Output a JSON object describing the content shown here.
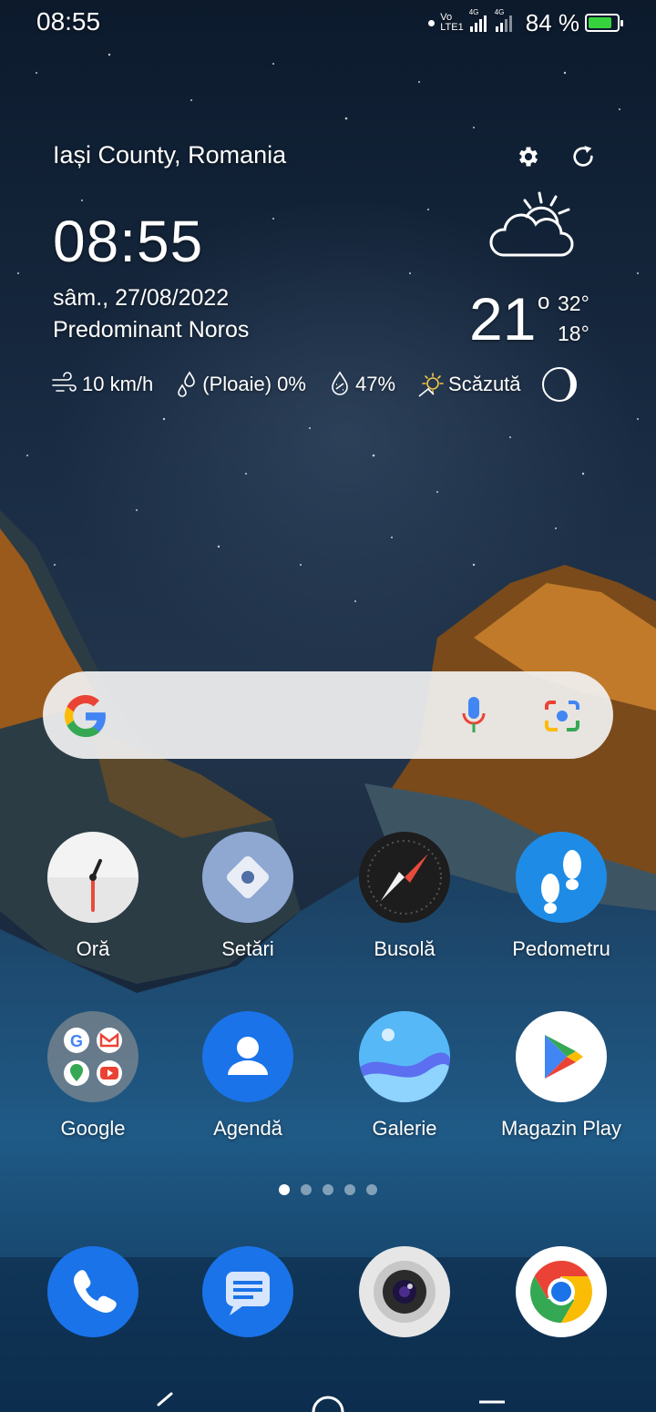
{
  "status_bar": {
    "time": "08:55",
    "volte_top": "Vo",
    "volte_bottom": "LTE1",
    "network_1": "4G",
    "network_2": "4G",
    "battery_percent": "84 %",
    "battery_level": 0.84,
    "battery_color": "#37d33e"
  },
  "weather": {
    "location": "Iași County, Romania",
    "time": "08:55",
    "date": "sâm., 27/08/2022",
    "condition": "Predominant Noros",
    "temperature": "21",
    "degree_symbol": "o",
    "high": "32°",
    "low": "18°",
    "wind": "10 km/h",
    "precipitation": "(Ploaie) 0%",
    "humidity": "47%",
    "uv": "Scăzută",
    "settings_icon": "gear-icon",
    "refresh_icon": "refresh-icon",
    "condition_icon": "partly-cloudy-icon",
    "moon_icon": "moon-phase-icon"
  },
  "search_bar": {
    "logo_icon": "google-g-icon",
    "mic_icon": "microphone-icon",
    "lens_icon": "lens-camera-icon"
  },
  "apps": [
    {
      "label": "Oră",
      "icon": "clock-icon"
    },
    {
      "label": "Setări",
      "icon": "settings-icon"
    },
    {
      "label": "Busolă",
      "icon": "compass-icon"
    },
    {
      "label": "Pedometru",
      "icon": "footsteps-icon"
    },
    {
      "label": "Google",
      "icon": "folder-icon"
    },
    {
      "label": "Agendă",
      "icon": "contacts-icon"
    },
    {
      "label": "Galerie",
      "icon": "gallery-icon"
    },
    {
      "label": "Magazin Play",
      "icon": "play-store-icon"
    }
  ],
  "pager": {
    "pages": 5,
    "current": 1
  },
  "dock": [
    {
      "icon": "phone-icon"
    },
    {
      "icon": "messages-icon"
    },
    {
      "icon": "camera-icon"
    },
    {
      "icon": "chrome-icon"
    }
  ]
}
